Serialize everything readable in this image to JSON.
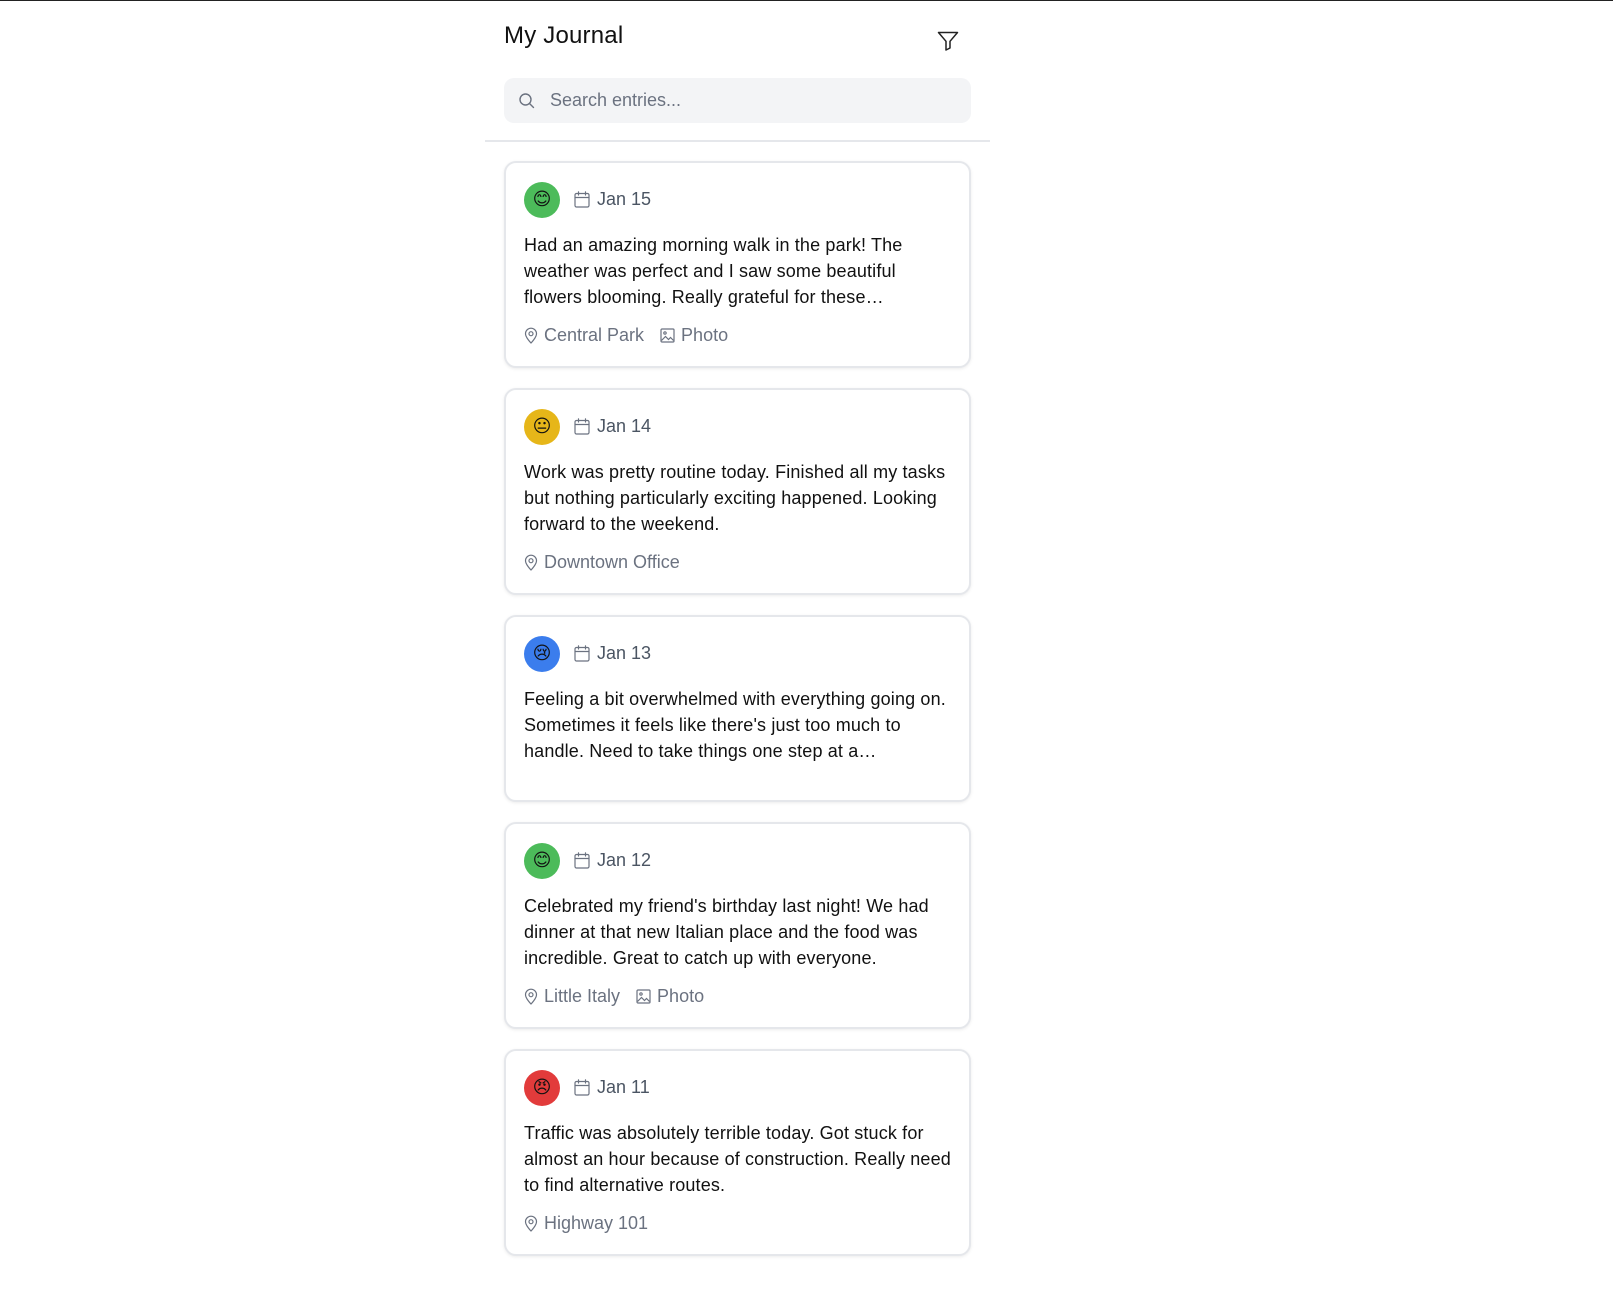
{
  "header": {
    "title": "My Journal"
  },
  "search": {
    "placeholder": "Search entries...",
    "value": ""
  },
  "colors": {
    "happy": "#4cbb5a",
    "neutral": "#e6b619",
    "sad": "#3b7ded",
    "angry": "#e23b3b"
  },
  "entries": [
    {
      "mood": "happy",
      "emoji": "😊",
      "date": "Jan 15",
      "text": "Had an amazing morning walk in the park! The weather was perfect and I saw some beautiful flowers blooming. Really grateful for these…",
      "location": "Central Park",
      "attachment": "Photo"
    },
    {
      "mood": "neutral",
      "emoji": "😐",
      "date": "Jan 14",
      "text": "Work was pretty routine today. Finished all my tasks but nothing particularly exciting happened. Looking forward to the weekend.",
      "location": "Downtown Office",
      "attachment": ""
    },
    {
      "mood": "sad",
      "emoji": "😢",
      "date": "Jan 13",
      "text": "Feeling a bit overwhelmed with everything going on. Sometimes it feels like there's just too much to handle. Need to take things one step at a…",
      "location": "",
      "attachment": ""
    },
    {
      "mood": "happy",
      "emoji": "😊",
      "date": "Jan 12",
      "text": "Celebrated my friend's birthday last night! We had dinner at that new Italian place and the food was incredible. Great to catch up with everyone.",
      "location": "Little Italy",
      "attachment": "Photo"
    },
    {
      "mood": "angry",
      "emoji": "😠",
      "date": "Jan 11",
      "text": "Traffic was absolutely terrible today. Got stuck for almost an hour because of construction. Really need to find alternative routes.",
      "location": "Highway 101",
      "attachment": ""
    }
  ]
}
